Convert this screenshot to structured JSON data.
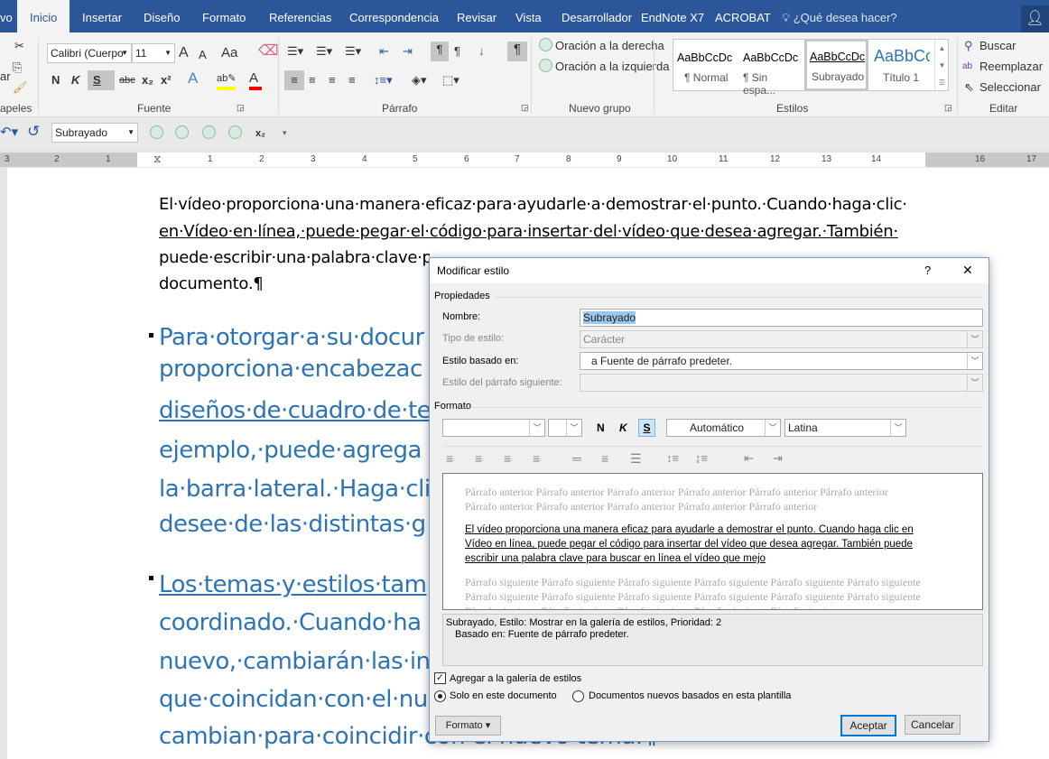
{
  "tabs": [
    "vo",
    "Inicio",
    "Insertar",
    "Diseño",
    "Formato",
    "Referencias",
    "Correspondencia",
    "Revisar",
    "Vista",
    "Desarrollador",
    "EndNote X7",
    "ACROBAT"
  ],
  "tell_me": "¿Qué desea hacer?",
  "ribbon": {
    "clipboard": {
      "paste_label": "ar",
      "group": "apeles"
    },
    "font": {
      "name": "Calibri (Cuerpo",
      "size": "11",
      "group": "Fuente",
      "bold": "N",
      "italic": "K",
      "underline": "S",
      "strike": "abc",
      "sub": "x₂",
      "sup": "x²",
      "grow": "A",
      "shrink": "A",
      "case": "Aa"
    },
    "paragraph": {
      "group": "Párrafo"
    },
    "nuevo_grupo": {
      "items": [
        "Oración a la derecha",
        "Oración a la izquierda"
      ],
      "group": "Nuevo grupo"
    },
    "styles": {
      "group": "Estilos",
      "items": [
        {
          "preview": "AaBbCcDc",
          "label": "¶ Normal"
        },
        {
          "preview": "AaBbCcDc",
          "label": "¶ Sin espa..."
        },
        {
          "preview": "AaBbCcDc",
          "label": "Subrayado"
        },
        {
          "preview": "AaBbCc",
          "label": "Título 1"
        }
      ]
    },
    "editing": {
      "group": "Editar",
      "items": [
        "Buscar",
        "Reemplazar",
        "Seleccionar"
      ]
    }
  },
  "qat": {
    "style_value": "Subrayado",
    "sub": "x₂"
  },
  "ruler": [
    "3",
    "2",
    "1",
    "1",
    "2",
    "3",
    "4",
    "5",
    "6",
    "7",
    "8",
    "9",
    "10",
    "11",
    "12",
    "13",
    "14",
    "16",
    "17"
  ],
  "document": {
    "p1": [
      "El·vídeo·proporciona·una·manera·eficaz·para·ayudarle·a·demostrar·el·punto.·Cuando·haga·clic·",
      "en·Vídeo·en·línea,·puede·pegar·el·código·para·insertar·del·vídeo·que·desea·agregar.·También·",
      "puede·escribir·una·palabra·clave·p",
      "documento.¶"
    ],
    "p2": [
      "Para·otorgar·a·su·docur",
      "proporciona·encabezac",
      "diseños·de·cuadro·de·te",
      "ejemplo,·puede·agrega",
      "la·barra·lateral.·Haga·cli",
      "desee·de·las·distintas·g"
    ],
    "p3": [
      "Los·temas·y·estilos·tam",
      "coordinado.·Cuando·ha",
      "nuevo,·cambiarán·las·in",
      "que·coincidan·con·el·nu",
      "cambian·para·coincidir·con·el·nuevo·tema.¶"
    ]
  },
  "dialog": {
    "title": "Modificar estilo",
    "help": "?",
    "close": "✕",
    "properties": "Propiedades",
    "name_label": "Nombre:",
    "name_value": "Subrayado",
    "type_label": "Tipo de estilo:",
    "type_value": "Carácter",
    "based_label": "Estilo basado en:",
    "based_value": "a Fuente de párrafo predeter.",
    "next_label": "Estilo del párrafo siguiente:",
    "format": "Formato",
    "bold": "N",
    "italic": "K",
    "underline": "S",
    "color": "Automático",
    "script": "Latina",
    "preview_prev": "Párrafo anterior Párrafo anterior Párrafo anterior Párrafo anterior Párrafo anterior Párrafo anterior Párrafo anterior Párrafo anterior Párrafo anterior Párrafo anterior Párrafo anterior",
    "preview_main": "El vídeo proporciona una manera eficaz para ayudarle a demostrar el punto. Cuando haga clic en Vídeo en línea, puede pegar el código para insertar del vídeo que desea agregar. También puede escribir una palabra clave para buscar en línea el vídeo que mejo",
    "preview_next": "Párrafo siguiente Párrafo siguiente Párrafo siguiente Párrafo siguiente Párrafo siguiente Párrafo siguiente Párrafo siguiente Párrafo siguiente Párrafo siguiente Párrafo siguiente Párrafo siguiente Párrafo siguiente Párrafo siguiente Párrafo siguiente Párrafo siguiente Párrafo siguiente Párrafo siguiente",
    "desc1": "Subrayado, Estilo: Mostrar en la galería de estilos, Prioridad: 2",
    "desc2": "Basado en: Fuente de párrafo predeter.",
    "add_gallery": "Agregar a la galería de estilos",
    "add_gallery_checked": true,
    "only_doc": "Solo en este documento",
    "new_docs": "Documentos nuevos basados en esta plantilla",
    "selected_scope": "Solo en este documento",
    "format_btn": "Formato ▾",
    "ok": "Aceptar",
    "cancel": "Cancelar"
  },
  "colors": {
    "title_bar": "#2b579a",
    "heading_blue": "#2e74b5",
    "highlight": "#ffff00",
    "font_color": "#ff0000"
  }
}
